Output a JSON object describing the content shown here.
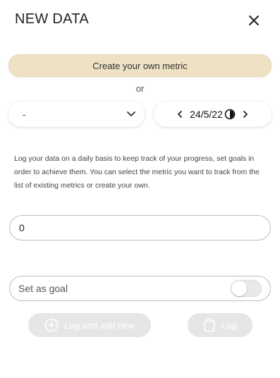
{
  "header": {
    "title": "NEW DATA",
    "close_icon": "close-icon"
  },
  "create_metric_button": {
    "label": "Create your own metric",
    "color": "#efe2c4"
  },
  "separator_text": "or",
  "metric_select": {
    "selected": "-",
    "icon": "chevron-down-icon"
  },
  "date_picker": {
    "date": "24/5/22",
    "prev_icon": "chevron-left-icon",
    "next_icon": "chevron-right-icon",
    "time_icon": "clock-icon"
  },
  "description": "Log your data on a daily basis to keep track of your progress, set goals in order to achieve them. You can select the metric you want to track from the list of existing metrics or create your own.",
  "value_input": {
    "value": "0"
  },
  "goal": {
    "label": "Set as goal",
    "enabled": false
  },
  "actions": {
    "log_and_add_new_label": "Log and add new",
    "log_label": "Log",
    "disabled_color": "#e6e6e6"
  }
}
